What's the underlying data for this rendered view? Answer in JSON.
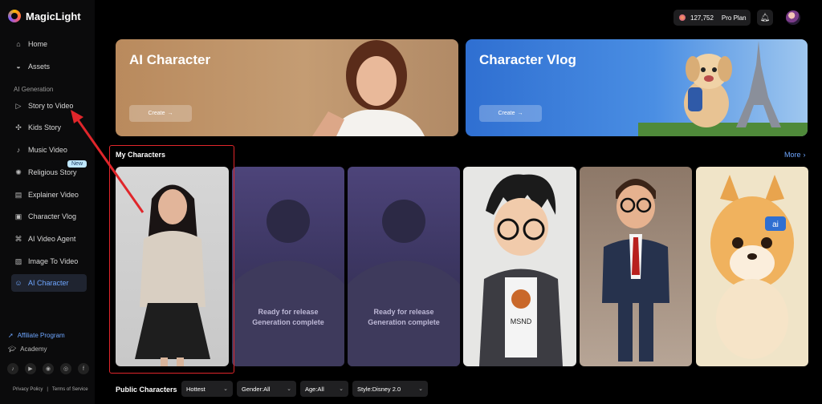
{
  "app": {
    "name": "MagicLight"
  },
  "sidebar": {
    "items_top": [
      {
        "label": "Home",
        "icon": "home-icon"
      },
      {
        "label": "Assets",
        "icon": "assets-icon"
      }
    ],
    "section_label": "AI Generation",
    "items": [
      {
        "label": "Story to Video",
        "icon": "play-icon"
      },
      {
        "label": "Kids Story",
        "icon": "puzzle-icon"
      },
      {
        "label": "Music Video",
        "icon": "music-icon"
      },
      {
        "label": "Religious Story",
        "icon": "sun-icon",
        "badge": "New"
      },
      {
        "label": "Explainer Video",
        "icon": "explainer-icon"
      },
      {
        "label": "Character Vlog",
        "icon": "vlog-icon"
      },
      {
        "label": "AI Video Agent",
        "icon": "agent-icon"
      },
      {
        "label": "Image To Video",
        "icon": "image-icon"
      },
      {
        "label": "AI Character",
        "icon": "character-icon",
        "active": true
      }
    ],
    "affiliate": "Affiliate Program",
    "academy": "Academy",
    "socials": [
      "tiktok-icon",
      "youtube-icon",
      "discord-icon",
      "instagram-icon",
      "facebook-icon"
    ],
    "footer": {
      "privacy": "Privacy Policy",
      "separator": "|",
      "terms": "Terms of Service"
    }
  },
  "topbar": {
    "credits": "127,752",
    "plan": "Pro Plan"
  },
  "banners": [
    {
      "title": "AI Character",
      "button": "Create"
    },
    {
      "title": "Character Vlog",
      "button": "Create"
    }
  ],
  "my_characters": {
    "label": "My Characters",
    "more": "More",
    "pending": [
      {
        "line1": "Ready for release",
        "line2": "Generation complete"
      },
      {
        "line1": "Ready for release",
        "line2": "Generation complete"
      }
    ],
    "badge_ai": "ai",
    "shirt_text": "MSND"
  },
  "public_characters": {
    "label": "Public Characters",
    "filters": [
      "Hottest",
      "Gender:All",
      "Age:All",
      "Style:Disney 2.0"
    ]
  },
  "colors": {
    "accent": "#6ea6ff",
    "highlight": "#e0262b",
    "new_badge": "#bfe7ff"
  }
}
